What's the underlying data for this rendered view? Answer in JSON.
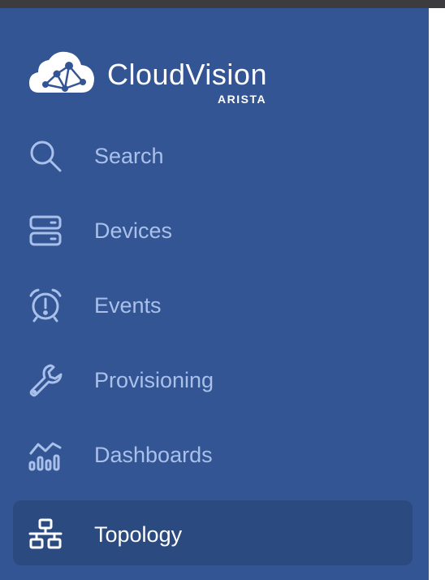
{
  "brand": {
    "name": "CloudVision",
    "sub": "ARISTA",
    "logo_icon": "cloud-network-icon"
  },
  "nav": {
    "items": [
      {
        "label": "Search",
        "icon": "search-icon",
        "active": false
      },
      {
        "label": "Devices",
        "icon": "server-icon",
        "active": false
      },
      {
        "label": "Events",
        "icon": "alarm-clock-icon",
        "active": false
      },
      {
        "label": "Provisioning",
        "icon": "wrench-icon",
        "active": false
      },
      {
        "label": "Dashboards",
        "icon": "dashboard-chart-icon",
        "active": false
      },
      {
        "label": "Topology",
        "icon": "topology-icon",
        "active": true
      }
    ]
  },
  "colors": {
    "sidebar_bg": "#335594",
    "active_bg": "#2b4a80",
    "inactive_text": "#a9c0ea",
    "active_text": "#ffffff"
  }
}
